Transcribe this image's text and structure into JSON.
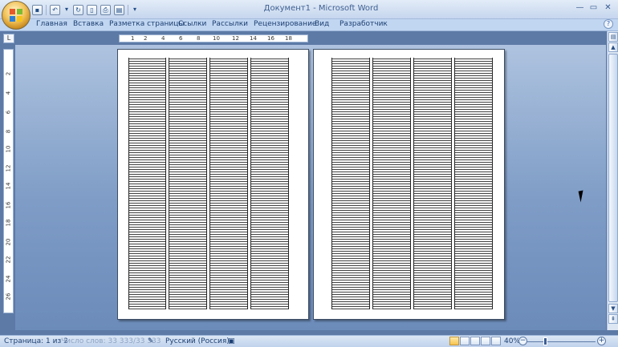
{
  "window": {
    "title": "Документ1 - Microsoft Word",
    "controls": {
      "minimize": "—",
      "maximize": "▭",
      "close": "✕"
    }
  },
  "quick_access": [
    {
      "icon": "save-icon",
      "glyph": "▪"
    },
    {
      "icon": "undo-icon",
      "glyph": "↶"
    },
    {
      "icon": "dropdown-icon",
      "glyph": "▾"
    },
    {
      "icon": "redo-icon",
      "glyph": "↻"
    },
    {
      "icon": "new-document-icon",
      "glyph": "▯"
    },
    {
      "icon": "print-icon",
      "glyph": "⎙"
    },
    {
      "icon": "print-preview-icon",
      "glyph": "▤"
    },
    {
      "icon": "customize-icon",
      "glyph": "▾"
    }
  ],
  "ribbon": {
    "tabs": [
      "Главная",
      "Вставка",
      "Разметка страницы",
      "Ссылки",
      "Рассылки",
      "Рецензирование",
      "Вид",
      "Разработчик"
    ],
    "help": "?"
  },
  "rulers": {
    "corner": "L",
    "horizontal_ticks": [
      "1",
      "2",
      "4",
      "6",
      "8",
      "10",
      "12",
      "14",
      "16",
      "18"
    ],
    "vertical_ticks": [
      "2",
      "4",
      "6",
      "8",
      "10",
      "12",
      "14",
      "16",
      "18",
      "20",
      "22",
      "24",
      "26"
    ]
  },
  "status": {
    "page": "Страница: 1 из 2",
    "words": "Число слов: 33 333/33 333",
    "language": "Русский (Россия)",
    "zoom": "40%",
    "zoom_minus": "−",
    "zoom_plus": "+"
  }
}
